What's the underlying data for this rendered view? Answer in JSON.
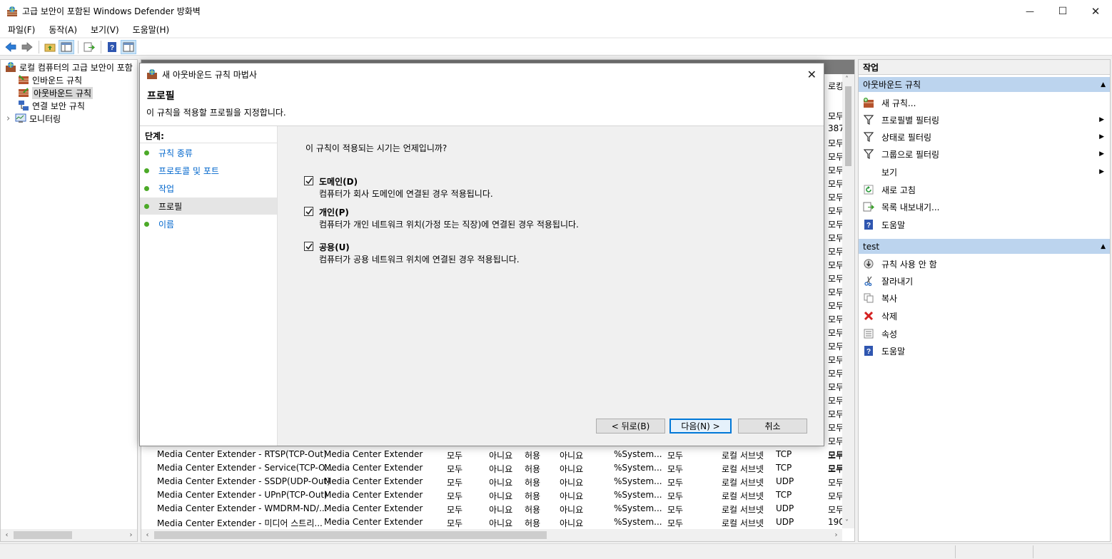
{
  "window": {
    "title": "고급 보안이 포함된 Windows Defender 방화벽",
    "minimize": "—",
    "maximize": "☐",
    "close": "✕"
  },
  "menu": [
    "파일(F)",
    "동작(A)",
    "보기(V)",
    "도움말(H)"
  ],
  "tree": {
    "root": "로컬 컴퓨터의 고급 보안이 포함",
    "items": [
      "인바운드 규칙",
      "아웃바운드 규칙",
      "연결 보안 규칙",
      "모니터링"
    ],
    "expander": "›",
    "scroll_left": "‹",
    "scroll_right": "›"
  },
  "list": {
    "right_column_cells": [
      "모두",
      "387",
      "모두",
      "모두",
      "모두",
      "모두",
      "모두",
      "모두",
      "모두",
      "모두",
      "모두",
      "모두",
      "모두",
      "모두",
      "모두",
      "모두",
      "모두",
      "모두",
      "모두",
      "모두",
      "모두",
      "모두",
      "모두",
      "모두",
      "모두",
      "모두",
      "모두"
    ],
    "header_partial": "로킹",
    "rows": [
      [
        "Media Center Extender - RTSP(TCP-Out)",
        "Media Center Extender",
        "모두",
        "아니요",
        "허용",
        "아니요",
        "%System...",
        "모두",
        "로컬 서브넷",
        "TCP",
        "모두"
      ],
      [
        "Media Center Extender - Service(TCP-O...",
        "Media Center Extender",
        "모두",
        "아니요",
        "허용",
        "아니요",
        "%System...",
        "모두",
        "로컬 서브넷",
        "TCP",
        "모두"
      ],
      [
        "Media Center Extender - SSDP(UDP-Out)",
        "Media Center Extender",
        "모두",
        "아니요",
        "허용",
        "아니요",
        "%System...",
        "모두",
        "로컬 서브넷",
        "UDP",
        "모두"
      ],
      [
        "Media Center Extender - UPnP(TCP-Out)",
        "Media Center Extender",
        "모두",
        "아니요",
        "허용",
        "아니요",
        "%System...",
        "모두",
        "로컬 서브넷",
        "TCP",
        "모두"
      ],
      [
        "Media Center Extender - WMDRM-ND/...",
        "Media Center Extender",
        "모두",
        "아니요",
        "허용",
        "아니요",
        "%System...",
        "모두",
        "로컬 서브넷",
        "UDP",
        "모두"
      ],
      [
        "Media Center Extender - 미디어 스트리...",
        "Media Center Extender",
        "모두",
        "아니요",
        "허용",
        "아니요",
        "%System...",
        "모두",
        "로컬 서브넷",
        "UDP",
        "190"
      ]
    ],
    "scroll_up": "˄",
    "scroll_down": "˅",
    "scroll_left": "‹",
    "scroll_right": "›"
  },
  "actions": {
    "header": "작업",
    "group1": {
      "title": "아웃바운드 규칙",
      "items": [
        "새 규칙...",
        "프로필별 필터링",
        "상태로 필터링",
        "그룹으로 필터링",
        "보기",
        "새로 고침",
        "목록 내보내기...",
        "도움말"
      ]
    },
    "group2": {
      "title": "test",
      "items": [
        "규칙 사용 안 함",
        "잘라내기",
        "복사",
        "삭제",
        "속성",
        "도움말"
      ]
    },
    "collapse": "▲",
    "submenu": "▶"
  },
  "dialog": {
    "title": "새 아웃바운드 규칙 마법사",
    "close": "✕",
    "heading": "프로필",
    "description": "이 규칙을 적용할 프로필을 지정합니다.",
    "steps_title": "단계:",
    "steps": [
      "규칙 종류",
      "프로토콜 및 포트",
      "작업",
      "프로필",
      "이름"
    ],
    "question": "이 규칙이 적용되는 시기는 언제입니까?",
    "options": [
      {
        "label": "도메인(D)",
        "desc": "컴퓨터가 회사 도메인에 연결된 경우 적용됩니다."
      },
      {
        "label": "개인(P)",
        "desc": "컴퓨터가 개인 네트워크 위치(가정 또는 직장)에 연결된 경우 적용됩니다."
      },
      {
        "label": "공용(U)",
        "desc": "컴퓨터가 공용 네트워크 위치에 연결된 경우 적용됩니다."
      }
    ],
    "buttons": {
      "back": "< 뒤로(B)",
      "next": "다음(N) >",
      "cancel": "취소"
    }
  },
  "colors": {
    "accent": "#0078d7",
    "step_dot": "#4caa28",
    "link": "#0066cc",
    "group_header": "#bcd4ee"
  }
}
